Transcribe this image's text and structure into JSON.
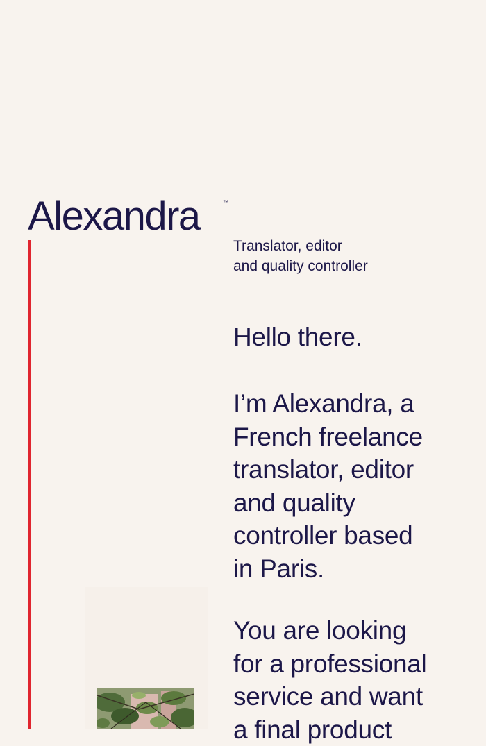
{
  "brand": {
    "name": "Alexandra",
    "trademark": "™"
  },
  "tagline": {
    "line1": "Translator, editor",
    "line2": "and quality controller"
  },
  "greeting": "Hello there.",
  "intro_lines": [
    "I’m Alexandra, a",
    "French freelance",
    "translator, editor",
    "and quality",
    "controller based",
    "in Paris."
  ],
  "pitch_lines": [
    "You are looking",
    "for a professional",
    "service and want",
    "a final product"
  ],
  "colors": {
    "background": "#f8f3ee",
    "text": "#1c1748",
    "accent": "#e0252f"
  },
  "photo": {
    "subject": "green-foliage-photo"
  }
}
